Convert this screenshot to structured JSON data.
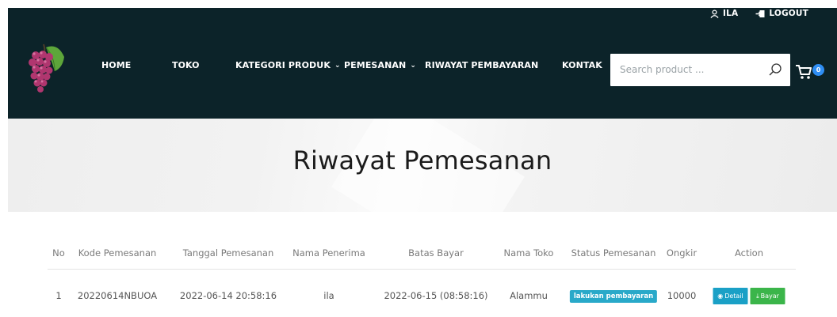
{
  "header": {
    "user_label": "ILA",
    "logout_label": "LOGOUT",
    "nav": [
      {
        "label": "HOME",
        "dropdown": false
      },
      {
        "label": "TOKO",
        "dropdown": false
      },
      {
        "label": "KATEGORI PRODUK",
        "dropdown": true
      },
      {
        "label": "PEMESANAN",
        "dropdown": true
      },
      {
        "label": "RIWAYAT PEMBAYARAN",
        "dropdown": false
      },
      {
        "label": "KONTAK",
        "dropdown": false
      }
    ],
    "search": {
      "placeholder": "Search product ..."
    },
    "cart_count": "0",
    "colors": {
      "bar": "#0c2329",
      "badge": "#2f8ef4"
    }
  },
  "hero": {
    "title": "Riwayat Pemesanan"
  },
  "table": {
    "columns": [
      "No",
      "Kode Pemesanan",
      "Tanggal Pemesanan",
      "Nama Penerima",
      "Batas Bayar",
      "Nama Toko",
      "Status Pemesanan",
      "Ongkir",
      "Action"
    ],
    "rows": [
      {
        "no": "1",
        "kode": "20220614NBUOA",
        "tanggal": "2022-06-14 20:58:16",
        "penerima": "ila",
        "batas": "2022-06-15 (08:58:16)",
        "toko": "Alammu",
        "status": "lakukan pembayaran",
        "ongkir": "10000",
        "detail_label": "Detail",
        "bayar_label": "Bayar"
      }
    ],
    "colors": {
      "status": "#29a9c9",
      "detail": "#1aa0c6",
      "bayar": "#3bb54a"
    }
  }
}
